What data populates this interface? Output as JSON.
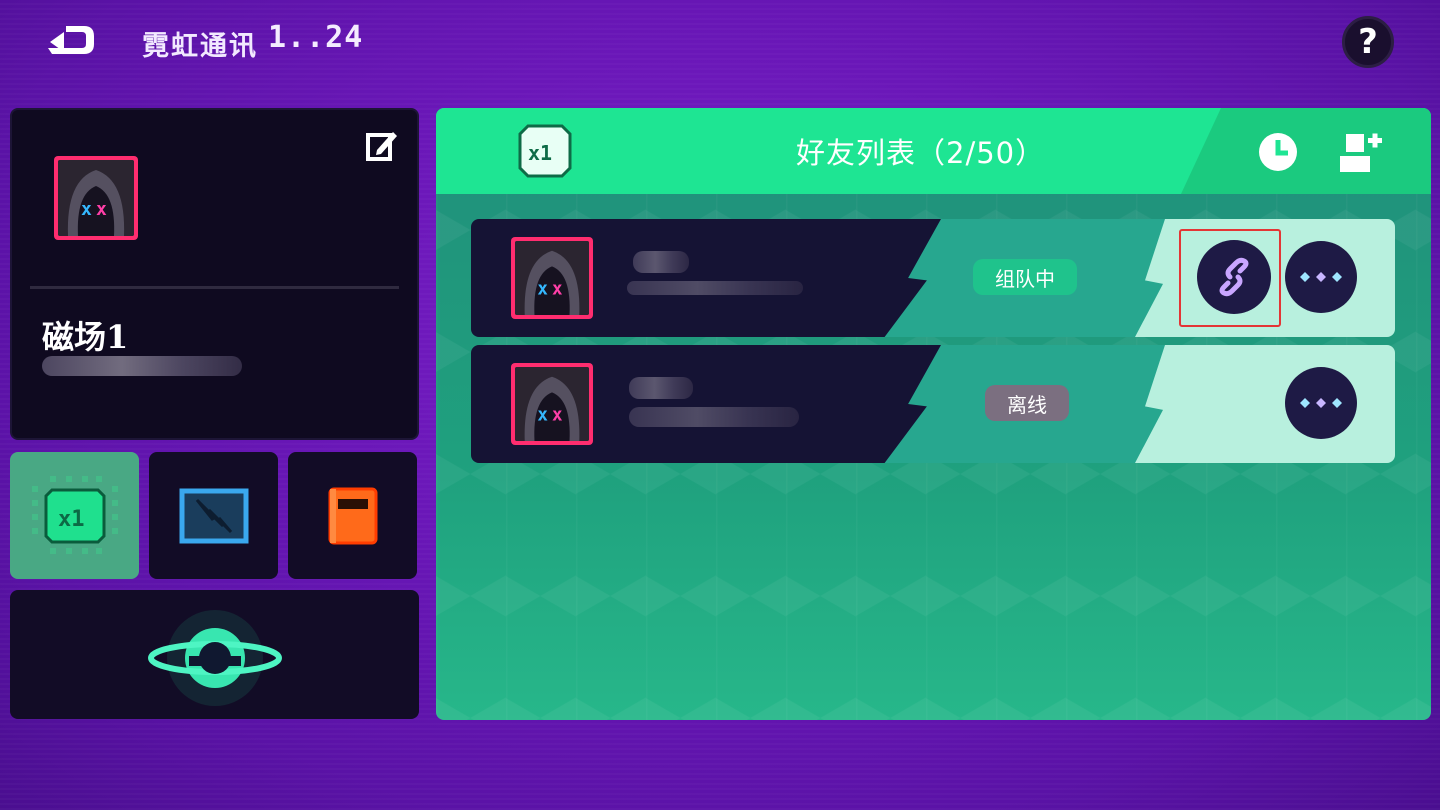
{
  "topbar": {
    "title": "霓虹通讯",
    "time": "1..24",
    "help_label": "?"
  },
  "profile": {
    "name": "磁场1"
  },
  "friends_panel": {
    "title": "好友列表（2/50）",
    "friends": [
      {
        "status": "组队中",
        "status_color": "#1fc38c"
      },
      {
        "status": "离线",
        "status_color": "#7b6f80"
      }
    ]
  },
  "colors": {
    "accent_green": "#1ee593",
    "avatar_border": "#ff2d6f",
    "panel_dark": "#0f0a20"
  }
}
